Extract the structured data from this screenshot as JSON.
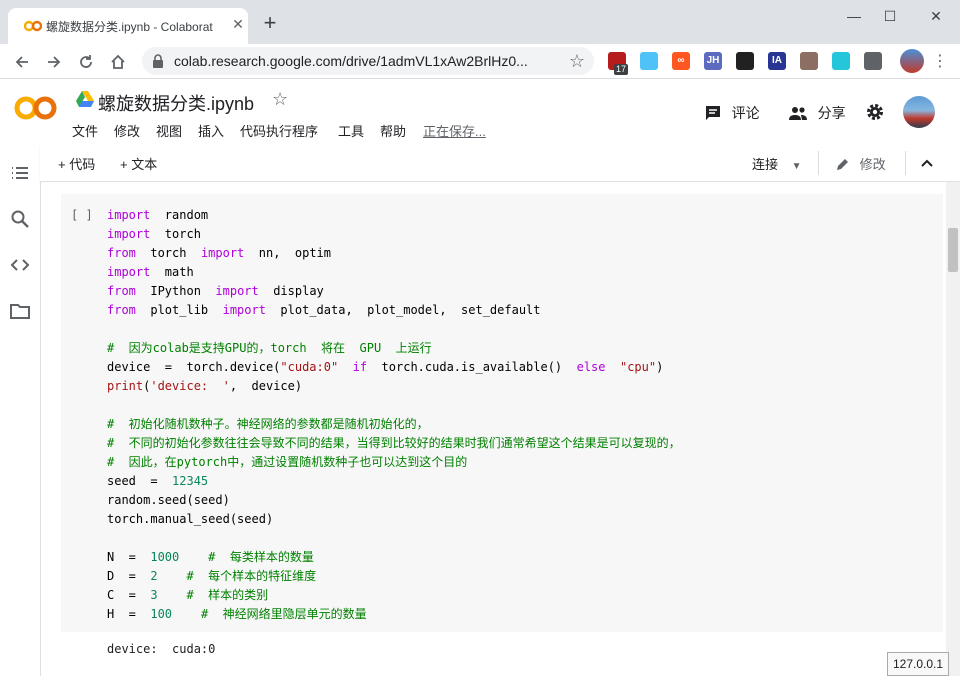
{
  "browser": {
    "tab_title": "螺旋数据分类.ipynb - Colaborat",
    "tab_close": "✕",
    "new_tab": "+",
    "window_controls": [
      "—",
      "☐",
      "✕"
    ],
    "url": "colab.research.google.com/drive/1admVL1xAw2BrlHz0...",
    "ext_badge": "17",
    "extensions": [
      {
        "icon": "ublock-icon",
        "label": "",
        "color": "#b71c1c"
      },
      {
        "icon": "globe-extension-icon",
        "label": "",
        "color": "#4fc3f7"
      },
      {
        "icon": "infinity-extension-icon",
        "label": "∞",
        "color": "#ff5722"
      },
      {
        "icon": "jh-extension-icon",
        "label": "JH",
        "color": "#5c6bc0"
      },
      {
        "icon": "glasses-extension-icon",
        "label": "",
        "color": "#212121"
      },
      {
        "icon": "ia-extension-icon",
        "label": "IA",
        "color": "#283593"
      },
      {
        "icon": "owl-extension-icon",
        "label": "",
        "color": "#8d6e63"
      },
      {
        "icon": "translate-extension-icon",
        "label": "",
        "color": "#26c6da"
      },
      {
        "icon": "puzzle-extension-icon",
        "label": "",
        "color": "#5f6368"
      }
    ]
  },
  "colab": {
    "logo_text": "CO",
    "notebook_title": "螺旋数据分类.ipynb",
    "menu": [
      "文件",
      "修改",
      "视图",
      "插入",
      "代码执行程序",
      "工具",
      "帮助"
    ],
    "saving_status": "正在保存...",
    "comment_label": "评论",
    "share_label": "分享"
  },
  "toolbar": {
    "add_code": "+ 代码",
    "add_text": "+ 文本",
    "connect": "连接",
    "edit": "修改"
  },
  "cell": {
    "run_label": "[ ]",
    "lines": [
      [
        {
          "t": "import",
          "c": "kw"
        },
        {
          "t": "  random"
        }
      ],
      [
        {
          "t": "import",
          "c": "kw"
        },
        {
          "t": "  torch"
        }
      ],
      [
        {
          "t": "from",
          "c": "kw"
        },
        {
          "t": "  torch  "
        },
        {
          "t": "import",
          "c": "kw"
        },
        {
          "t": "  nn,  optim"
        }
      ],
      [
        {
          "t": "import",
          "c": "kw"
        },
        {
          "t": "  math"
        }
      ],
      [
        {
          "t": "from",
          "c": "kw"
        },
        {
          "t": "  IPython  "
        },
        {
          "t": "import",
          "c": "kw"
        },
        {
          "t": "  display"
        }
      ],
      [
        {
          "t": "from",
          "c": "kw"
        },
        {
          "t": "  plot_lib  "
        },
        {
          "t": "import",
          "c": "kw"
        },
        {
          "t": "  plot_data,  plot_model,  set_default"
        }
      ],
      [],
      [
        {
          "t": "#  因为colab是支持GPU的，torch  将在  GPU  上运行",
          "c": "cm"
        }
      ],
      [
        {
          "t": "device  =  torch.device("
        },
        {
          "t": "\"cuda:0\"",
          "c": "str"
        },
        {
          "t": "  "
        },
        {
          "t": "if",
          "c": "kw"
        },
        {
          "t": "  torch.cuda.is_available()  "
        },
        {
          "t": "else",
          "c": "kw"
        },
        {
          "t": "  "
        },
        {
          "t": "\"cpu\"",
          "c": "str"
        },
        {
          "t": ")"
        }
      ],
      [
        {
          "t": "print",
          "c": "str"
        },
        {
          "t": "("
        },
        {
          "t": "'device:  '",
          "c": "str"
        },
        {
          "t": ",  device)"
        }
      ],
      [],
      [
        {
          "t": "#  初始化随机数种子。神经网络的参数都是随机初始化的，",
          "c": "cm"
        }
      ],
      [
        {
          "t": "#  不同的初始化参数往往会导致不同的结果，当得到比较好的结果时我们通常希望这个结果是可以复现的，",
          "c": "cm"
        }
      ],
      [
        {
          "t": "#  因此，在pytorch中，通过设置随机数种子也可以达到这个目的",
          "c": "cm"
        }
      ],
      [
        {
          "t": "seed  =  "
        },
        {
          "t": "12345",
          "c": "num"
        }
      ],
      [
        {
          "t": "random.seed(seed)"
        }
      ],
      [
        {
          "t": "torch.manual_seed(seed)"
        }
      ],
      [],
      [
        {
          "t": "N  =  "
        },
        {
          "t": "1000",
          "c": "num"
        },
        {
          "t": "    "
        },
        {
          "t": "#  每类样本的数量",
          "c": "cm"
        }
      ],
      [
        {
          "t": "D  =  "
        },
        {
          "t": "2",
          "c": "num"
        },
        {
          "t": "    "
        },
        {
          "t": "#  每个样本的特征维度",
          "c": "cm"
        }
      ],
      [
        {
          "t": "C  =  "
        },
        {
          "t": "3",
          "c": "num"
        },
        {
          "t": "    "
        },
        {
          "t": "#  样本的类别",
          "c": "cm"
        }
      ],
      [
        {
          "t": "H  =  "
        },
        {
          "t": "100",
          "c": "num"
        },
        {
          "t": "    "
        },
        {
          "t": "#  神经网络里隐层单元的数量",
          "c": "cm"
        }
      ]
    ],
    "output": "device:  cuda:0"
  },
  "status": {
    "host": "127.0.0.1"
  }
}
